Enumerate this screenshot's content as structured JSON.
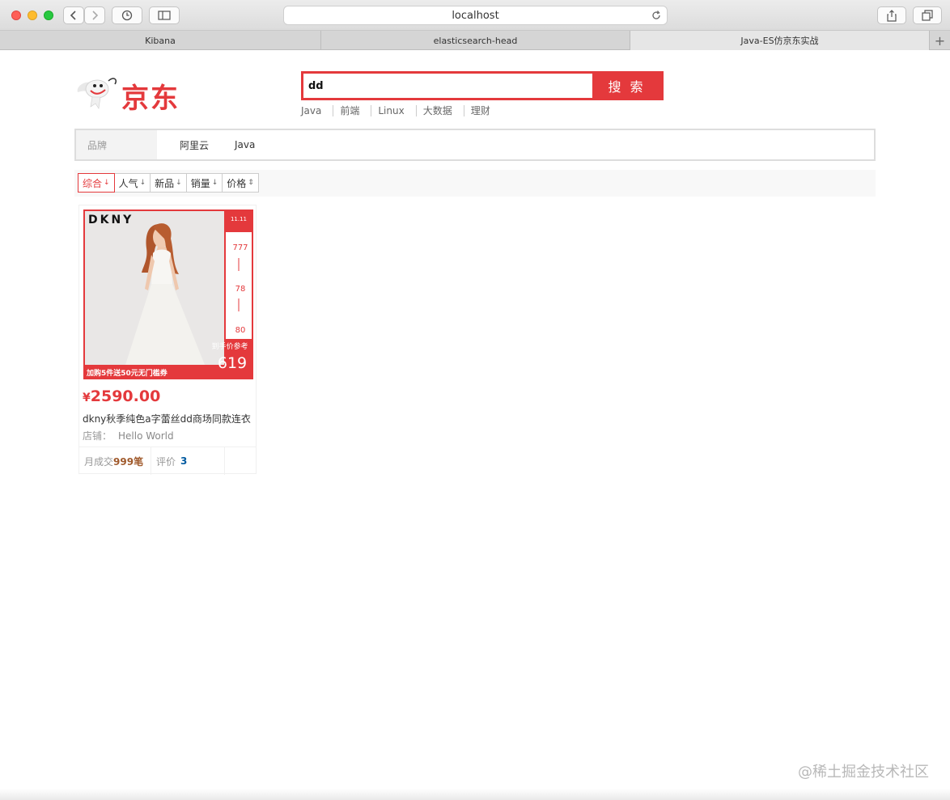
{
  "browser": {
    "address": "localhost",
    "tabs": [
      {
        "label": "Kibana"
      },
      {
        "label": "elasticsearch-head"
      },
      {
        "label": "Java-ES仿京东实战"
      }
    ],
    "new_tab_label": "+"
  },
  "header": {
    "logo_text": "京东",
    "search": {
      "value": "dd",
      "button_label": "搜 索"
    },
    "hot_words": [
      "Java",
      "前端",
      "Linux",
      "大数据",
      "理财"
    ]
  },
  "filter": {
    "brand_label": "品牌",
    "brands": [
      "阿里云",
      "Java"
    ]
  },
  "sort": {
    "items": [
      {
        "label": "综合",
        "arrow": "↓"
      },
      {
        "label": "人气",
        "arrow": "↓"
      },
      {
        "label": "新品",
        "arrow": "↓"
      },
      {
        "label": "销量",
        "arrow": "↓"
      },
      {
        "label": "价格",
        "arrow": "⇕"
      }
    ]
  },
  "product": {
    "image_brand": "DKNY",
    "image_prices": [
      "777",
      "78",
      "80"
    ],
    "image_final_label": "到手价参考",
    "image_final_price": "619",
    "image_banner": "加购5件送50元无门槛券",
    "currency": "¥",
    "price": "2590.00",
    "title": "dkny秋季纯色a字蕾丝dd商场同款连衣",
    "shop_label": "店铺：",
    "shop_name": "Hello World",
    "sold_label": "月成交",
    "sold_value": "999笔",
    "review_label": "评价",
    "review_value": "3"
  },
  "watermark": "@稀土掘金技术社区",
  "colors": {
    "accent": "#e4393c",
    "link_blue": "#005aa0"
  }
}
